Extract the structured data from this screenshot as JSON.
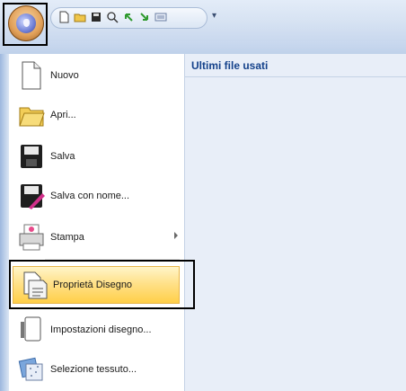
{
  "toolbar": {
    "app_button_icon": "application-orb-icon",
    "quick_access": [
      {
        "name": "new-icon"
      },
      {
        "name": "open-folder-icon"
      },
      {
        "name": "save-icon"
      },
      {
        "name": "zoom-icon"
      },
      {
        "name": "undo-icon"
      },
      {
        "name": "redo-icon"
      },
      {
        "name": "screen-icon"
      }
    ],
    "customize_glyph": "▾"
  },
  "recent": {
    "header": "Ultimi file usati"
  },
  "menu": {
    "items": [
      {
        "label": "Nuovo",
        "icon": "new-document-icon"
      },
      {
        "label": "Apri...",
        "icon": "open-folder-icon"
      },
      {
        "label": "Salva",
        "icon": "save-disk-icon"
      },
      {
        "label": "Salva con nome...",
        "icon": "save-as-icon"
      },
      {
        "label": "Stampa",
        "icon": "printer-icon",
        "has_submenu": true
      },
      {
        "label": "Proprietà Disegno",
        "icon": "design-properties-icon",
        "selected": true
      },
      {
        "label": "Impostazioni disegno...",
        "icon": "design-settings-icon"
      },
      {
        "label": "Selezione tessuto...",
        "icon": "fabric-selection-icon"
      }
    ]
  },
  "colors": {
    "accent": "#15428b",
    "selected_top": "#fff5c9",
    "selected_bottom": "#ffcf48"
  }
}
